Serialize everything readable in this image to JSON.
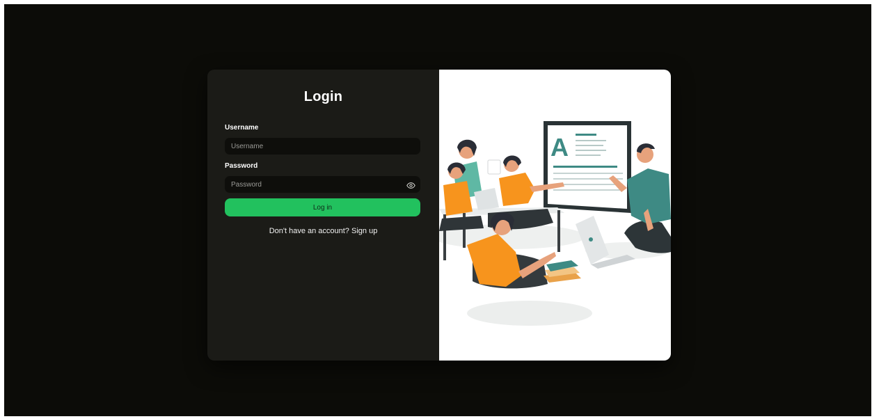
{
  "login": {
    "title": "Login",
    "username_label": "Username",
    "username_placeholder": "Username",
    "username_value": "",
    "password_label": "Password",
    "password_placeholder": "Password",
    "password_value": "",
    "show_password_icon": "eye-icon",
    "submit_label": "Log in",
    "signup_prompt": "Don't have an account?",
    "signup_link": "Sign up"
  },
  "illustration": {
    "name": "classroom-illustration",
    "board_letter": "A"
  },
  "colors": {
    "page_background": "#0c0c08",
    "form_panel": "#1b1b17",
    "input_background": "#0e0e0b",
    "accent_green": "#22c15e",
    "illustration_orange": "#f7941d",
    "illustration_teal": "#3e8a84"
  }
}
